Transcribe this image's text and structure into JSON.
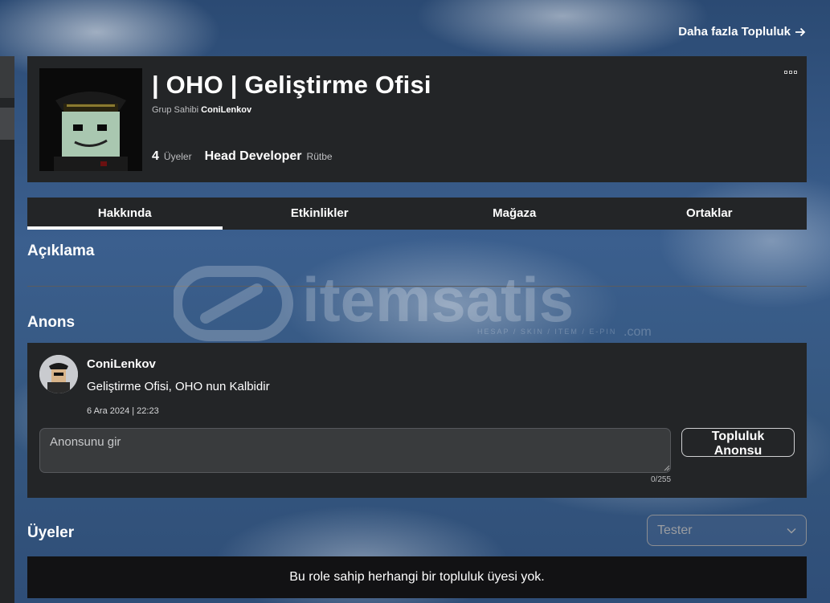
{
  "top_link": {
    "label": "Daha fazla Topluluk"
  },
  "group": {
    "title": "| OHO | Geliştirme Ofisi",
    "owner_label": "Grup Sahibi",
    "owner_name": "ConiLenkov",
    "member_count": "4",
    "member_label": "Üyeler",
    "rank_name": "Head Developer",
    "rank_label": "Rütbe"
  },
  "tabs": [
    {
      "label": "Hakkında",
      "active": true
    },
    {
      "label": "Etkinlikler",
      "active": false
    },
    {
      "label": "Mağaza",
      "active": false
    },
    {
      "label": "Ortaklar",
      "active": false
    }
  ],
  "description": {
    "heading": "Açıklama"
  },
  "announcement": {
    "heading": "Anons",
    "user": "ConiLenkov",
    "text": "Geliştirme Ofisi, OHO nun Kalbidir",
    "date": "6 Ara 2024 | 22:23",
    "input_placeholder": "Anonsunu gir",
    "char_count": "0/255",
    "button_label": "Topluluk Anonsu"
  },
  "members": {
    "heading": "Üyeler",
    "role_selected": "Tester",
    "empty_text": "Bu role sahip herhangi bir topluluk üyesi yok."
  },
  "watermark": {
    "brand": "itemsatis",
    "tagline": "HESAP / SKIN / ITEM / E-PIN",
    "suffix": ".com"
  },
  "colors": {
    "card": "#232527",
    "tab_active": "#ffffff",
    "empty_card": "#121214"
  },
  "icons": [
    "arrow-right-icon",
    "more-options-icon",
    "chevron-down-icon",
    "resize-grip-icon"
  ]
}
